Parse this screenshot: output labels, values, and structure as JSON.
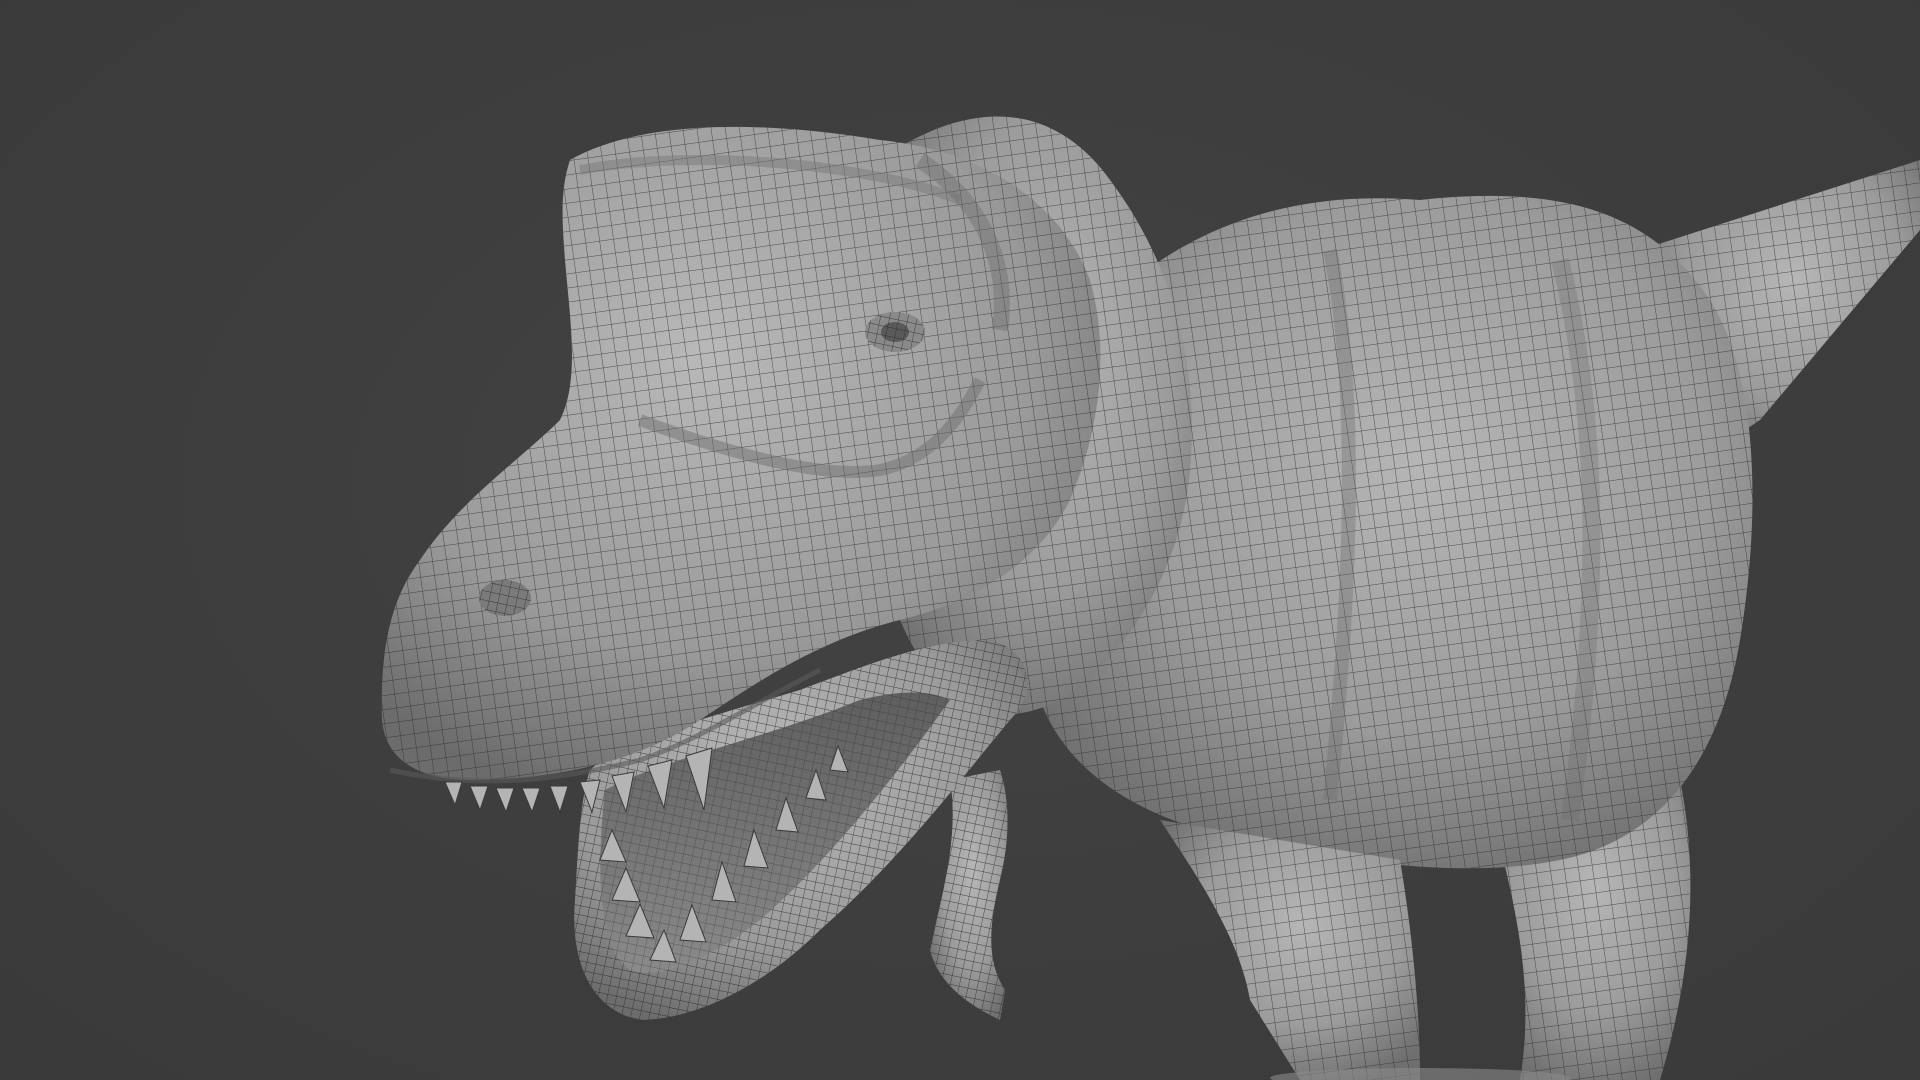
{
  "viewport": {
    "background_color": "#3d3d3d",
    "mesh_color": "#9a9a9a",
    "wire_color": "#222222",
    "subject": "t-rex-wireframe-mesh"
  }
}
